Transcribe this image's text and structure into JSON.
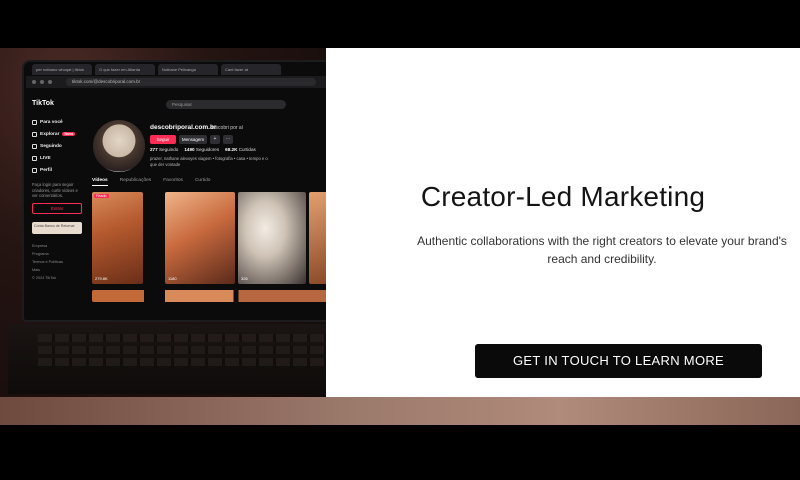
{
  "hero": {
    "headline": "Creator-Led Marketing",
    "subtext": "Authentic collaborations with the right creators to elevate your brand's reach and credibility.",
    "cta_label": "GET IN TOUCH TO LEARN MORE"
  },
  "photo": {
    "browser_tabs": [
      "per notbano whoqat | tiktok",
      "O que fazer em Atlanta",
      "Notbane Pelicanga",
      "Cant fazer at"
    ],
    "url": "tiktok.com/@descobriporal.com.br",
    "tiktok": {
      "logo": "TikTok",
      "search_placeholder": "Pesquisar",
      "sidebar": [
        {
          "label": "Para você",
          "icon": "home-icon"
        },
        {
          "label": "Explorar",
          "icon": "compass-icon",
          "badge": "Novo"
        },
        {
          "label": "Seguindo",
          "icon": "users-icon"
        },
        {
          "label": "LIVE",
          "icon": "live-icon"
        },
        {
          "label": "Perfil",
          "icon": "user-icon"
        }
      ],
      "login_note": "Faça login para seguir criadores, curtir vídeos e ver comentários.",
      "login_button": "Entrar",
      "promo_text": "Conta Banco de Retornar",
      "footer_links": [
        "Empresa",
        "Programa",
        "Termos e Políticas",
        "Mais",
        "© 2024 TikTok"
      ],
      "profile": {
        "name": "descobriporal.com.br",
        "handle": "descobri por aí",
        "follow": "Seguir",
        "message": "Mensagem",
        "stats": [
          {
            "value": "277",
            "label": "Seguindo"
          },
          {
            "value": "1490",
            "label": "Seguidores"
          },
          {
            "value": "68.2K",
            "label": "Curtidas"
          }
        ],
        "bio": "prazer, nathane alexoyes viagem • fotografia • casa • tempo e o que der vontade"
      },
      "tabs": [
        "Vídeos",
        "Republicações",
        "Favoritos",
        "Curtido"
      ],
      "videos": [
        {
          "views": "279.8K",
          "pinned": "Fixado"
        },
        {
          "views": "1180",
          "pinned": ""
        },
        {
          "views": "326",
          "pinned": ""
        },
        {
          "views": "",
          "pinned": ""
        }
      ]
    }
  }
}
